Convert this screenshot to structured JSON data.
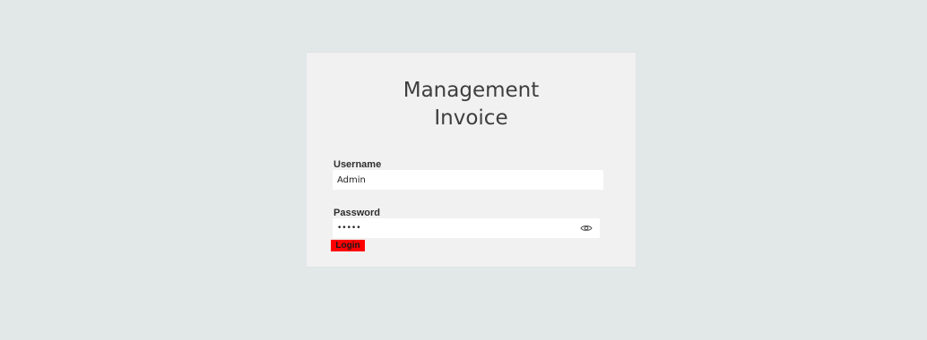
{
  "form": {
    "title": "Management\nInvoice",
    "username_label": "Username",
    "username_value": "Admin",
    "password_label": "Password",
    "password_value": "•••••",
    "password_toggle_icon": "eye-icon",
    "login_label": "Login"
  },
  "colors": {
    "page_background": "#e2e8e7",
    "card_background": "#f1f1f1",
    "input_background": "#ffffff",
    "login_button": "#ff0000",
    "title_text": "#3e3e3e"
  }
}
